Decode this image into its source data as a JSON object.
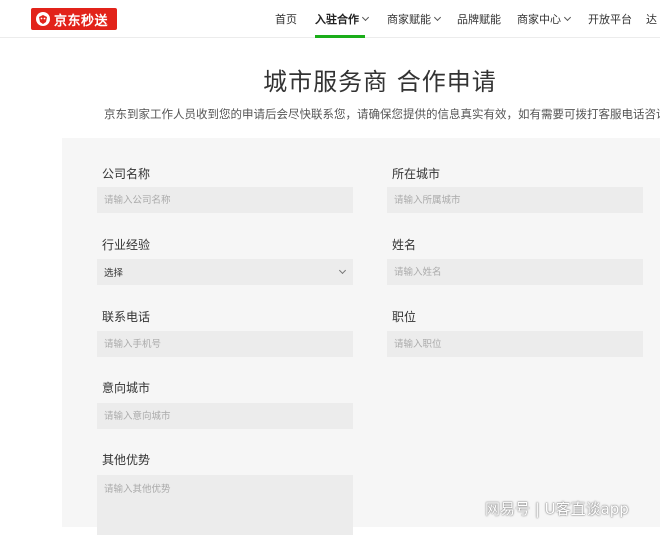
{
  "brand": {
    "logo_text": "京东秒送"
  },
  "nav": {
    "items": [
      {
        "label": "首页"
      },
      {
        "label": "入驻合作"
      },
      {
        "label": "商家赋能"
      },
      {
        "label": "品牌赋能"
      },
      {
        "label": "商家中心"
      },
      {
        "label": "开放平台"
      },
      {
        "label": "达"
      }
    ]
  },
  "page": {
    "title": "城市服务商 合作申请",
    "subtitle": "京东到家工作人员收到您的申请后会尽快联系您，请确保您提供的信息真实有效，如有需要可拨打客服电话咨询。"
  },
  "form": {
    "company_name": {
      "label": "公司名称",
      "placeholder": "请输入公司名称"
    },
    "city": {
      "label": "所在城市",
      "placeholder": "请输入所属城市"
    },
    "industry": {
      "label": "行业经验",
      "value": "选择"
    },
    "name": {
      "label": "姓名",
      "placeholder": "请输入姓名"
    },
    "phone": {
      "label": "联系电话",
      "placeholder": "请输入手机号"
    },
    "position": {
      "label": "职位",
      "placeholder": "请输入职位"
    },
    "intent_city": {
      "label": "意向城市",
      "placeholder": "请输入意向城市"
    },
    "other": {
      "label": "其他优势",
      "placeholder": "请输入其他优势"
    }
  },
  "watermark": "网易号 | U客直谈app",
  "colors": {
    "brand_red": "#e2231a",
    "accent_green": "#1aad19"
  }
}
